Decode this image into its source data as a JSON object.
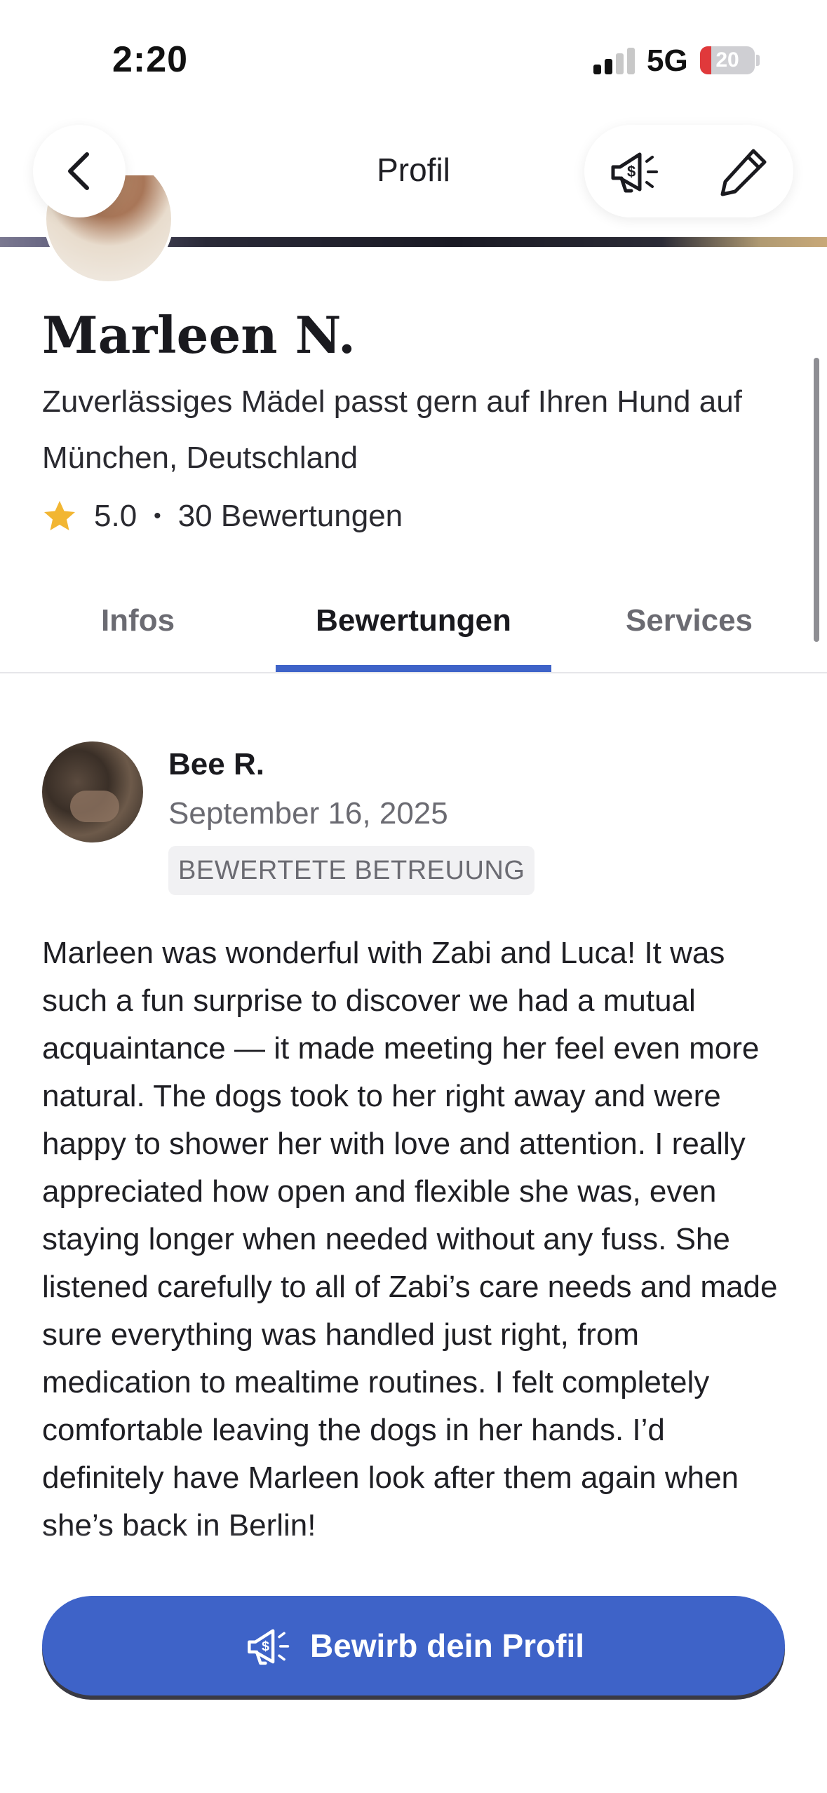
{
  "status_bar": {
    "time": "2:20",
    "network": "5G",
    "battery": "20",
    "battery_level": 0.2
  },
  "header": {
    "title": "Profil",
    "back_icon": "chevron-left-icon",
    "promo_icon": "megaphone-dollar-icon",
    "edit_icon": "pencil-icon"
  },
  "profile": {
    "name": "Marleen N.",
    "tagline": "Zuverlässiges Mädel passt gern auf Ihren Hund auf",
    "location": "München, Deutschland",
    "rating": "5.0",
    "separator": "•",
    "reviews_count": "30 Bewertungen"
  },
  "tabs": [
    {
      "label": "Infos",
      "active": false
    },
    {
      "label": "Bewertungen",
      "active": true
    },
    {
      "label": "Services",
      "active": false
    }
  ],
  "review": {
    "reviewer": "Bee R.",
    "date": "September 16, 2025",
    "badge": "BEWERTETE BETREUUNG",
    "text": "Marleen was wonderful with Zabi and Luca! It was such a fun surprise to discover we had a mutual acquaintance — it made meeting her feel even more natural. The dogs took to her right away and were happy to shower her with love and attention. I really appreciated how open and flexible she was, even staying longer when needed without any fuss. She listened carefully to all of Zabi’s care needs and made sure everything was handled just right, from medication to mealtime routines. I felt completely comfortable leaving the dogs in her hands. I’d definitely have Marleen look after them again when she’s back in Berlin!"
  },
  "promote_button": {
    "label": "Bewirb dein Profil",
    "icon": "megaphone-dollar-icon"
  },
  "colors": {
    "accent": "#3e63c8",
    "star": "#f2b632",
    "battery_low": "#e0393b"
  }
}
